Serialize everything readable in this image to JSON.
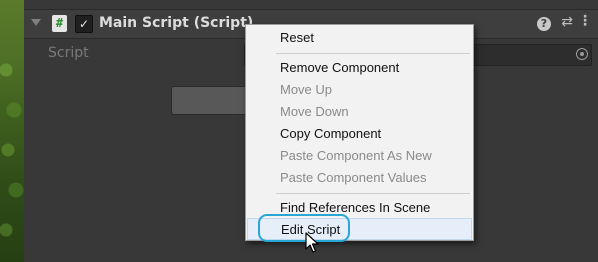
{
  "component": {
    "script_icon": "#",
    "script_icon_name": "csharp-script-icon",
    "enabled_check": "✓",
    "title": "Main Script (Script)",
    "help_icon": "?",
    "preset_icon": "⇄",
    "more_icon": "⋮"
  },
  "script_property": {
    "label": "Script"
  },
  "context_menu": {
    "items": [
      {
        "label": "Reset",
        "enabled": true
      },
      {
        "label": "Remove Component",
        "enabled": true
      },
      {
        "label": "Move Up",
        "enabled": false
      },
      {
        "label": "Move Down",
        "enabled": false
      },
      {
        "label": "Copy Component",
        "enabled": true
      },
      {
        "label": "Paste Component As New",
        "enabled": false
      },
      {
        "label": "Paste Component Values",
        "enabled": false
      },
      {
        "label": "Find References In Scene",
        "enabled": true
      },
      {
        "label": "Edit Script",
        "enabled": true,
        "highlighted": true
      }
    ]
  },
  "colors": {
    "focus_ring": "#2aa6d6",
    "menu_bg": "#f2f2f2",
    "inspector_bg": "#383838"
  }
}
